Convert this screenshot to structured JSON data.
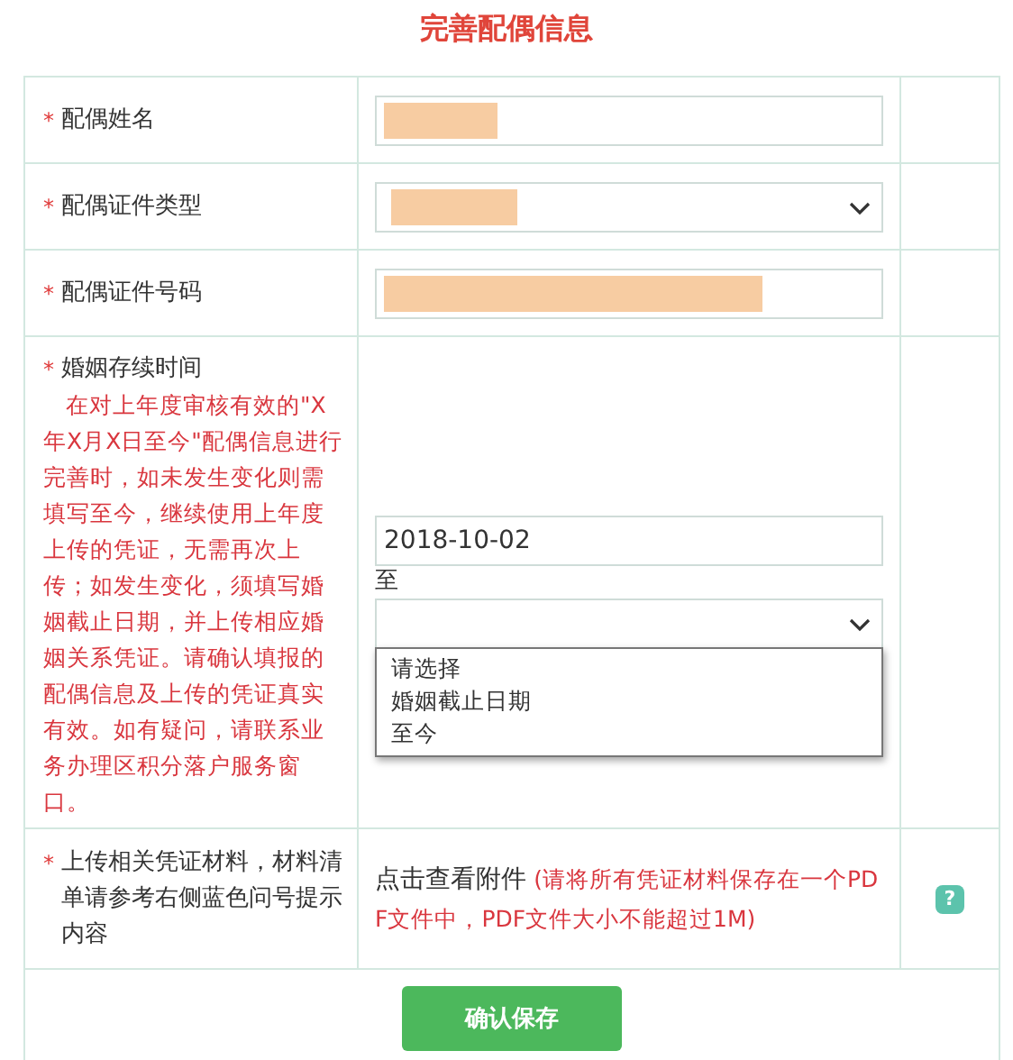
{
  "title": "完善配偶信息",
  "rows": [
    {
      "kind": "text",
      "required_mark": "*",
      "label": "配偶姓名",
      "redacted": true
    },
    {
      "kind": "select",
      "required_mark": "*",
      "label": "配偶证件类型",
      "redacted": true
    },
    {
      "kind": "text",
      "required_mark": "*",
      "label": "配偶证件号码",
      "redacted": true
    },
    {
      "kind": "date_range",
      "required_mark": "*",
      "label": "婚姻存续时间",
      "note": "在对上年度审核有效的\"X年X月X日至今\"配偶信息进行完善时，如未发生变化则需填写至今，继续使用上年度上传的凭证，无需再次上传；如发生变化，须填写婚姻截止日期，并上传相应婚姻关系凭证。请确认填报的配偶信息及上传的凭证真实有效。如有疑问，请联系业务办理区积分落户服务窗口。",
      "start_value": "2018-10-02",
      "separator": "至",
      "end_select": {
        "expanded": true,
        "options": [
          "请选择",
          "婚姻截止日期",
          "至今"
        ]
      }
    },
    {
      "kind": "upload",
      "required_mark": "*",
      "label": "上传相关凭证材料，材料清单请参考右侧蓝色问号提示内容",
      "link": "点击查看附件",
      "hint": "(请将所有凭证材料保存在一个PDF文件中，PDF文件大小不能超过1M)",
      "help": "?"
    }
  ],
  "button": "确认保存"
}
